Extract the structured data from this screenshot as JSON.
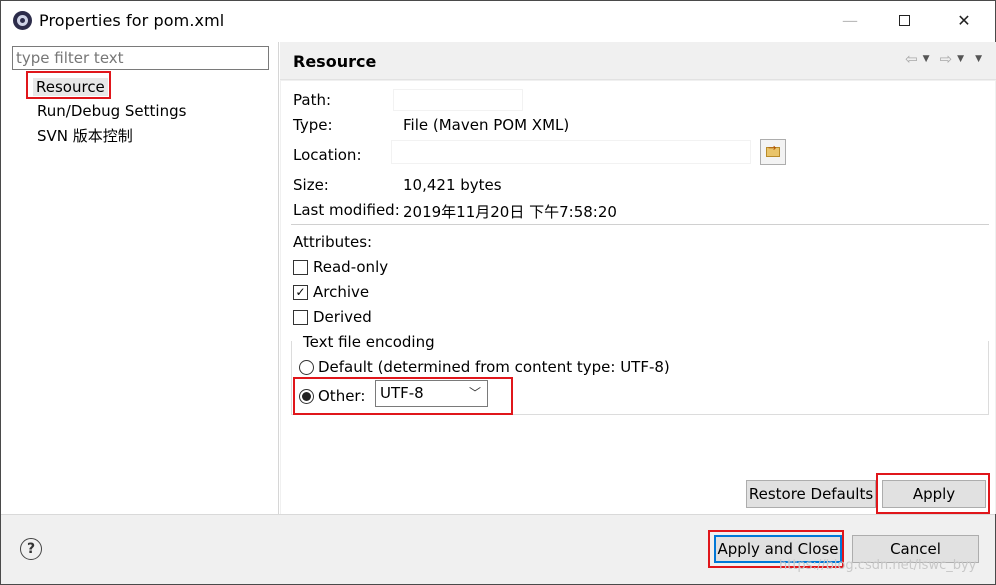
{
  "window": {
    "title": "Properties for pom.xml",
    "minimize_glyph": "—",
    "close_glyph": "✕"
  },
  "left_pane": {
    "filter_placeholder": "type filter text",
    "items": [
      {
        "label": "Resource",
        "selected": true
      },
      {
        "label": "Run/Debug Settings",
        "selected": false
      },
      {
        "label": "SVN 版本控制",
        "selected": false
      }
    ]
  },
  "right_pane": {
    "title": "Resource",
    "nav": {
      "back_glyph": "⇦",
      "forward_glyph": "⇨",
      "dropdown_glyph": "▼"
    },
    "fields": {
      "path_label": "Path:",
      "type_label": "Type:",
      "type_value": "File  (Maven POM XML)",
      "location_label": "Location:",
      "size_label": "Size:",
      "size_value": "10,421  bytes",
      "modified_label": "Last modified:",
      "modified_value": "2019年11月20日 下午7:58:20"
    },
    "attributes": {
      "heading": "Attributes:",
      "read_only": {
        "label": "Read-only",
        "checked": false
      },
      "archive": {
        "label": "Archive",
        "checked": true
      },
      "derived": {
        "label": "Derived",
        "checked": false
      }
    },
    "encoding": {
      "legend": "Text file encoding",
      "default_option": "Default (determined from content type: UTF-8)",
      "other_option": "Other:",
      "selected": "other",
      "other_value": "UTF-8"
    },
    "restore_defaults_label": "Restore Defaults",
    "apply_label": "Apply"
  },
  "bottom": {
    "help_glyph": "?",
    "apply_close_label": "Apply and Close",
    "cancel_label": "Cancel"
  },
  "watermark": "https://blog.csdn.net/lswc_byy",
  "colors": {
    "highlight_box": "#e0161b",
    "default_button_border": "#0078d7",
    "pane_background": "#f0f0f0"
  }
}
